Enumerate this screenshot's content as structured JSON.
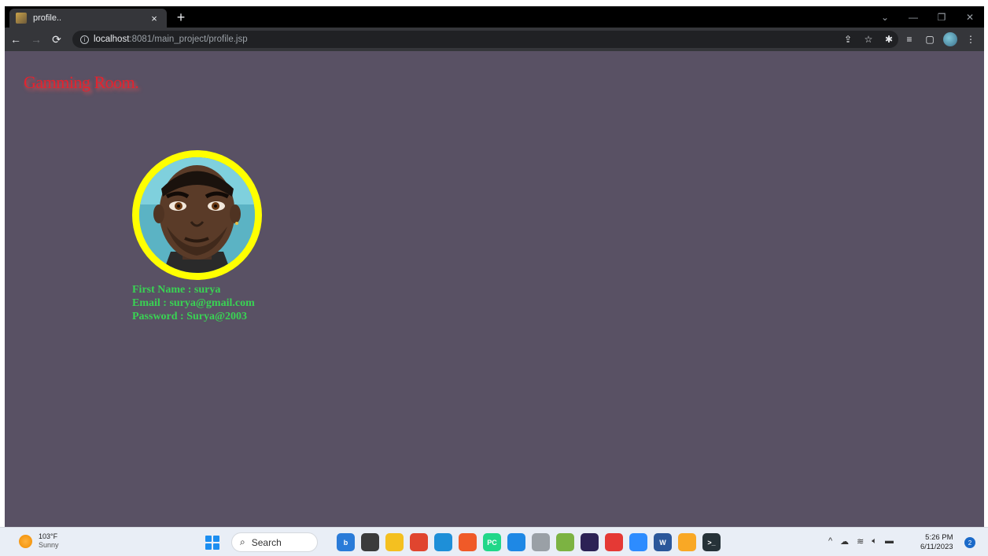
{
  "browser": {
    "tab_title": "profile..",
    "tab_close": "×",
    "new_tab": "+",
    "url_host": "localhost",
    "url_rest": ":8081/main_project/profile.jsp",
    "window_controls": [
      "⌄",
      "—",
      "❐",
      "✕"
    ]
  },
  "page": {
    "brand": "Gamming Room.",
    "profile": {
      "first_name_line": "First Name : surya",
      "email_line": "Email : surya@gmail.com",
      "password_line": "Password : Surya@2003"
    },
    "colors": {
      "background": "#595164",
      "brand": "#e3232f",
      "ring": "#ffff00",
      "info_text": "#39d353"
    }
  },
  "taskbar": {
    "weather_temp": "103°F",
    "weather_cond": "Sunny",
    "search_label": "Search",
    "time": "5:26 PM",
    "date": "6/11/2023",
    "notification_count": "2",
    "apps": [
      {
        "name": "bing-chat-icon",
        "color": "#2a7bd8",
        "glyph": "b"
      },
      {
        "name": "task-view-icon",
        "color": "#3b3b3b",
        "glyph": ""
      },
      {
        "name": "file-explorer-icon",
        "color": "#f4c020",
        "glyph": ""
      },
      {
        "name": "chrome-icon",
        "color": "#e0452f",
        "glyph": ""
      },
      {
        "name": "edge-icon",
        "color": "#1e8fd8",
        "glyph": ""
      },
      {
        "name": "brave-icon",
        "color": "#f05a28",
        "glyph": ""
      },
      {
        "name": "pycharm-icon",
        "color": "#21d789",
        "glyph": "PC"
      },
      {
        "name": "vscode-icon",
        "color": "#1e88e5",
        "glyph": ""
      },
      {
        "name": "database-icon",
        "color": "#9aa0a6",
        "glyph": ""
      },
      {
        "name": "image-viewer-icon",
        "color": "#7cb342",
        "glyph": ""
      },
      {
        "name": "eclipse-icon",
        "color": "#2c2255",
        "glyph": ""
      },
      {
        "name": "store-icon",
        "color": "#e53935",
        "glyph": ""
      },
      {
        "name": "zoom-icon",
        "color": "#2d8cff",
        "glyph": ""
      },
      {
        "name": "word-icon",
        "color": "#2b579a",
        "glyph": "W"
      },
      {
        "name": "chrome-canary-icon",
        "color": "#f9a825",
        "glyph": ""
      },
      {
        "name": "terminal-icon",
        "color": "#263238",
        "glyph": ">_"
      }
    ]
  }
}
